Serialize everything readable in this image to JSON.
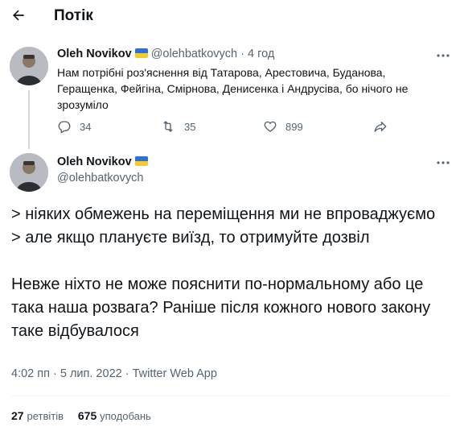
{
  "header": {
    "title": "Потік"
  },
  "reply_tweet": {
    "name": "Oleh Novikov",
    "handle": "@olehbatkovych",
    "separator": "·",
    "time": "4 год",
    "text": "Нам потрібні роз'яснення від Татарова, Арестовича, Буданова, Геращенка, Фейгіна, Смірнова, Денисенка і Андрусіва, бо нічого не зрозуміло",
    "replies": "34",
    "retweets": "35",
    "likes": "899"
  },
  "main_tweet": {
    "name": "Oleh Novikov",
    "handle": "@olehbatkovych",
    "lines": [
      "> ніяких обмежень на переміщення ми не впроваджуємо",
      "> але якщо плануєте виїзд, то отримуйте дозвіл",
      "Невже ніхто не може пояснити по-нормальному або це така наша розвага? Раніше після кожного нового закону таке відбувалося"
    ],
    "meta_time": "4:02 пп",
    "meta_date": "5 лип. 2022",
    "meta_sep": "·",
    "meta_app": "Twitter Web App",
    "retweets_count": "27",
    "retweets_label": "ретвітів",
    "likes_count": "675",
    "likes_label": "уподобань"
  },
  "icons": {
    "back": "arrow-left-icon",
    "more": "more-dots-icon",
    "reply": "reply-bubble-icon",
    "retweet": "retweet-icon",
    "like": "heart-icon",
    "share": "share-icon",
    "flag": "ukraine-flag-icon"
  },
  "colors": {
    "text": "#0f1419",
    "secondary": "#536471",
    "divider": "#eff3f4",
    "flag_blue": "#2f6fd6",
    "flag_yellow": "#f3cb2c"
  }
}
